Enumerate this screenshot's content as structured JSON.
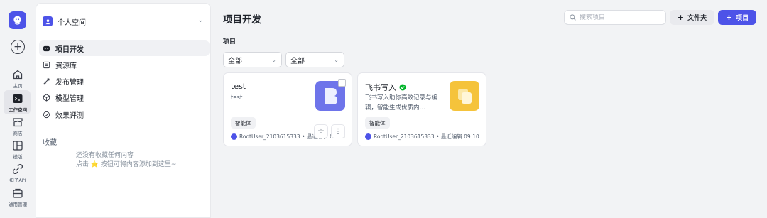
{
  "rail": {
    "items": [
      {
        "label": "主页",
        "icon": "home-icon"
      },
      {
        "label": "工作空间",
        "icon": "workspace-icon"
      },
      {
        "label": "商店",
        "icon": "store-icon"
      },
      {
        "label": "模版",
        "icon": "template-icon"
      },
      {
        "label": "扣子API",
        "icon": "api-icon"
      },
      {
        "label": "通用管理",
        "icon": "management-icon"
      }
    ]
  },
  "sidebar": {
    "space_name": "个人空间",
    "nav": [
      {
        "label": "项目开发",
        "icon": "project-icon"
      },
      {
        "label": "资源库",
        "icon": "library-icon"
      },
      {
        "label": "发布管理",
        "icon": "publish-icon"
      },
      {
        "label": "模型管理",
        "icon": "model-icon"
      },
      {
        "label": "效果评测",
        "icon": "evaluation-icon"
      }
    ],
    "favorites_title": "收藏",
    "favorites_empty_line1": "还没有收藏任何内容",
    "favorites_empty_line2": "点击 ⭐ 按钮可将内容添加到这里~"
  },
  "main": {
    "title": "项目开发",
    "search_placeholder": "搜索项目",
    "folder_button": "文件夹",
    "project_button": "项目",
    "section_label": "项目",
    "filters": [
      "全部",
      "全部"
    ],
    "cards": [
      {
        "title": "test",
        "description": "test",
        "tag": "智能体",
        "owner": "RootUser_2103615333 • 最近编辑 09:10"
      },
      {
        "title": "飞书写入",
        "description": "飞书写入助你高效记录与编辑，智能生成优质内…",
        "tag": "智能体",
        "owner": "RootUser_2103615333 • 最近编辑 09:10"
      }
    ]
  },
  "colors": {
    "accent": "#4d53e8",
    "verified": "#00b42a",
    "thumb_purple": "#6e74ea",
    "thumb_yellow": "#f5c33b"
  }
}
